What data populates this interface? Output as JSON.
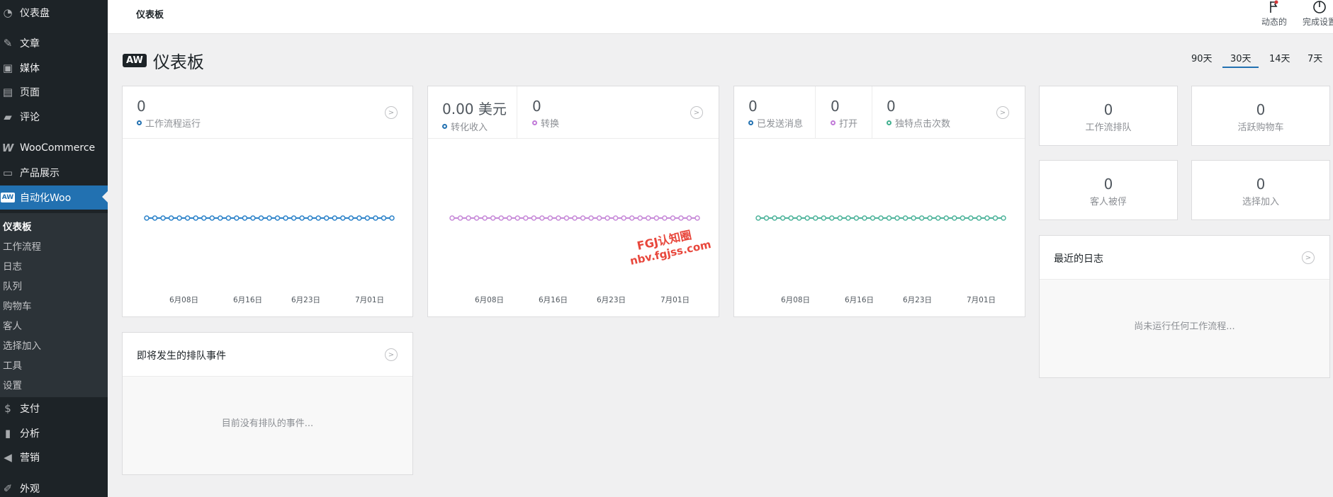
{
  "sidebar": {
    "items": [
      {
        "label": "仪表盘",
        "icon": "gauge-icon"
      },
      {
        "label": "文章",
        "icon": "pushpin-icon"
      },
      {
        "label": "媒体",
        "icon": "media-icon"
      },
      {
        "label": "页面",
        "icon": "page-icon"
      },
      {
        "label": "评论",
        "icon": "comment-icon"
      },
      {
        "label": "WooCommerce",
        "icon": "woo-icon"
      },
      {
        "label": "产品展示",
        "icon": "archive-icon"
      },
      {
        "label": "自动化Woo",
        "icon": "aw-icon"
      },
      {
        "label": "支付",
        "icon": "dollar-icon"
      },
      {
        "label": "分析",
        "icon": "bar-chart-icon"
      },
      {
        "label": "营销",
        "icon": "megaphone-icon"
      },
      {
        "label": "外观",
        "icon": "brush-icon"
      }
    ],
    "submenu": [
      "仪表板",
      "工作流程",
      "日志",
      "队列",
      "购物车",
      "客人",
      "选择加入",
      "工具",
      "设置"
    ]
  },
  "topbar": {
    "title": "仪表板",
    "activity_label": "动态的",
    "finish_setup_label": "完成设置"
  },
  "page": {
    "logo_text": "AW",
    "title": "仪表板"
  },
  "range_tabs": [
    "90天",
    "30天",
    "14天",
    "7天"
  ],
  "active_range": "30天",
  "cards": {
    "workflows": {
      "metrics": [
        {
          "value": "0",
          "label": "工作流程运行",
          "color": "#2271b1"
        }
      ]
    },
    "conversions": {
      "metrics": [
        {
          "value": "0.00 美元",
          "label": "转化收入",
          "color": "#2271b1"
        },
        {
          "value": "0",
          "label": "转换",
          "color": "#c17ad8"
        }
      ]
    },
    "emails": {
      "metrics": [
        {
          "value": "0",
          "label": "已发送消息",
          "color": "#2271b1"
        },
        {
          "value": "0",
          "label": "打开",
          "color": "#c17ad8"
        },
        {
          "value": "0",
          "label": "独特点击次数",
          "color": "#41b08f"
        }
      ]
    }
  },
  "x_ticks": [
    "6月08日",
    "6月16日",
    "6月23日",
    "7月01日"
  ],
  "series_colors": {
    "workflows": "#2b82c9",
    "conversions": "#c689d8",
    "emails": "#4cb39a"
  },
  "chart_data": [
    {
      "type": "line",
      "x": [
        "6月08日",
        "6月16日",
        "6月23日",
        "7月01日"
      ],
      "series": [
        {
          "name": "工作流程运行",
          "values": [
            0,
            0,
            0,
            0,
            0,
            0,
            0,
            0,
            0,
            0,
            0,
            0,
            0,
            0,
            0,
            0,
            0,
            0,
            0,
            0,
            0,
            0,
            0,
            0,
            0,
            0,
            0,
            0,
            0,
            0,
            0
          ]
        }
      ]
    },
    {
      "type": "line",
      "x": [
        "6月08日",
        "6月16日",
        "6月23日",
        "7月01日"
      ],
      "series": [
        {
          "name": "转化收入",
          "values": [
            0,
            0,
            0,
            0,
            0,
            0,
            0,
            0,
            0,
            0,
            0,
            0,
            0,
            0,
            0,
            0,
            0,
            0,
            0,
            0,
            0,
            0,
            0,
            0,
            0,
            0,
            0,
            0,
            0,
            0,
            0
          ]
        }
      ]
    },
    {
      "type": "line",
      "x": [
        "6月08日",
        "6月16日",
        "6月23日",
        "7月01日"
      ],
      "series": [
        {
          "name": "已发送消息",
          "values": [
            0,
            0,
            0,
            0,
            0,
            0,
            0,
            0,
            0,
            0,
            0,
            0,
            0,
            0,
            0,
            0,
            0,
            0,
            0,
            0,
            0,
            0,
            0,
            0,
            0,
            0,
            0,
            0,
            0,
            0,
            0
          ]
        }
      ]
    }
  ],
  "stats": [
    {
      "value": "0",
      "label": "工作流排队"
    },
    {
      "value": "0",
      "label": "活跃购物车"
    },
    {
      "value": "0",
      "label": "客人被俘"
    },
    {
      "value": "0",
      "label": "选择加入"
    }
  ],
  "queued_panel": {
    "title": "即将发生的排队事件",
    "empty": "目前没有排队的事件..."
  },
  "logs_panel": {
    "title": "最近的日志",
    "empty": "尚未运行任何工作流程..."
  },
  "watermark": {
    "line1": "FGJ认知圈",
    "line2": "nbv.fgjss.com"
  }
}
